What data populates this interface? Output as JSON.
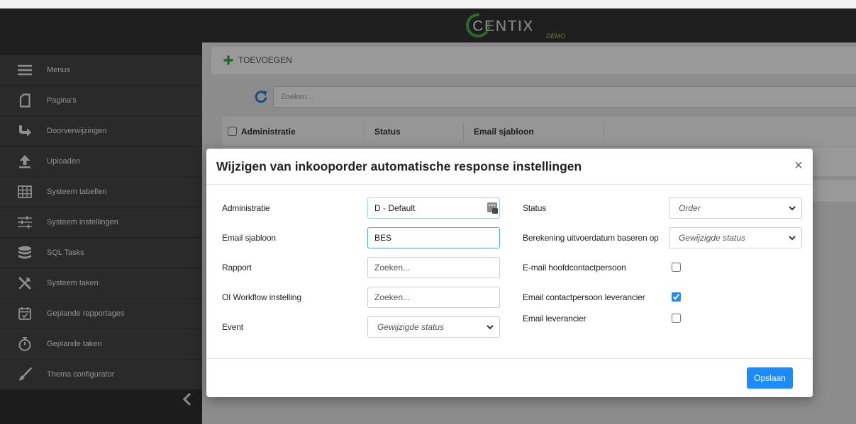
{
  "app": {
    "logo_name": "CENTIX",
    "logo_tag": "DEMO"
  },
  "sidebar": {
    "items": [
      {
        "label": "Menus",
        "icon": "menu-icon"
      },
      {
        "label": "Pagina's",
        "icon": "page-icon"
      },
      {
        "label": "Doorverwijzingen",
        "icon": "redirect-icon"
      },
      {
        "label": "Uploaden",
        "icon": "upload-icon"
      },
      {
        "label": "Systeem tabellen",
        "icon": "table-icon"
      },
      {
        "label": "Systeem instellingen",
        "icon": "sliders-icon"
      },
      {
        "label": "SQL Tasks",
        "icon": "database-icon"
      },
      {
        "label": "Systeem taken",
        "icon": "tools-icon"
      },
      {
        "label": "Geplande rapportages",
        "icon": "calendar-check-icon"
      },
      {
        "label": "Geplande taken",
        "icon": "stopwatch-icon"
      },
      {
        "label": "Thema configurator",
        "icon": "brush-icon"
      }
    ],
    "collapse_icon": "chevron-left-icon"
  },
  "toolbar": {
    "add_label": "TOEVOEGEN",
    "add_icon": "plus-icon"
  },
  "list": {
    "refresh_icon": "refresh-icon",
    "search_placeholder": "Zoeken...",
    "columns": [
      "Administratie",
      "Status",
      "Email sjabloon"
    ]
  },
  "modal": {
    "title": "Wijzigen van inkooporder automatische response instellingen",
    "close_label": "×",
    "left_fields": [
      {
        "label": "Administratie",
        "value": "D - Default",
        "icon": "lookup-icon"
      },
      {
        "label": "Email sjabloon",
        "value": "BES"
      },
      {
        "label": "Rapport",
        "placeholder": "Zoeken..."
      },
      {
        "label": "OI Workflow instelling",
        "placeholder": "Zoeken..."
      },
      {
        "label": "Event",
        "value": "Gewijzigde status"
      }
    ],
    "right_fields": [
      {
        "label": "Status",
        "value": "Order"
      },
      {
        "label": "Berekening uitvoerdatum baseren op",
        "value": "Gewijzigde status"
      },
      {
        "label": "E-mail hoofdcontactpersoon",
        "checked": false
      },
      {
        "label": "Email contactpersoon leverancier",
        "checked": true
      },
      {
        "label": "Email leverancier",
        "checked": false
      }
    ],
    "save_label": "Opslaan"
  },
  "colors": {
    "accent": "#1a8cff",
    "add_green": "#3aa335",
    "refresh_blue": "#2b7fd6",
    "logo_green": "#48b04a",
    "sidebar_bg": "#474747",
    "header_bg": "#333333"
  }
}
